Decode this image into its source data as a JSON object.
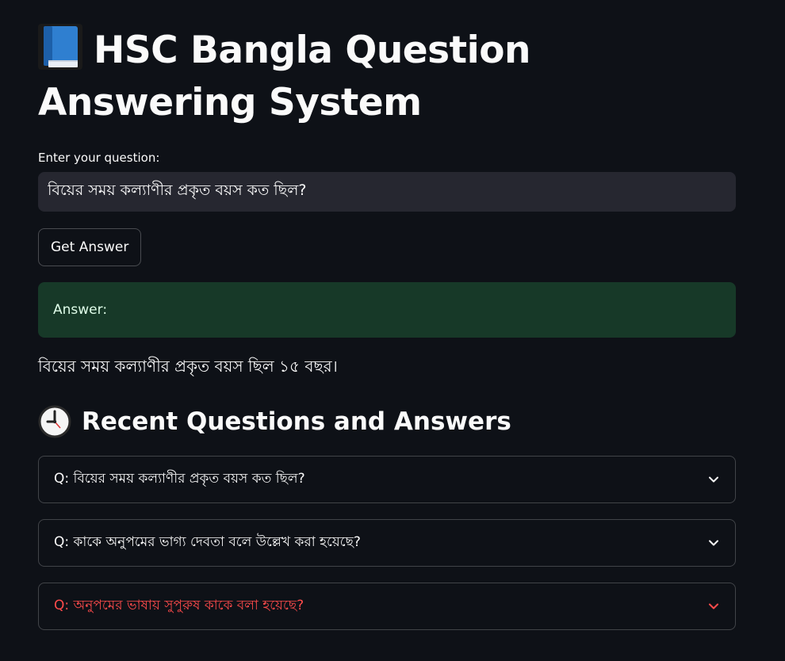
{
  "header": {
    "icon": "blue-book-icon",
    "title": "HSC Bangla Question Answering System"
  },
  "form": {
    "label": "Enter your question:",
    "value": "বিয়ের সময় কল্যাণীর প্রকৃত বয়স কত ছিল?",
    "button_label": "Get Answer"
  },
  "result": {
    "heading": "Answer:",
    "text": "বিয়ের সময় কল্যাণীর প্রকৃত বয়স ছিল ১৫ বছর।"
  },
  "recent": {
    "icon": "clock-icon",
    "title": "Recent Questions and Answers",
    "items": [
      {
        "label": "Q: বিয়ের সময় কল্যাণীর প্রকৃত বয়স কত ছিল?"
      },
      {
        "label": "Q: কাকে অনুপমের ভাগ্য দেবতা বলে উল্লেখ করা হয়েছে?"
      },
      {
        "label": "Q: অনুপমের ভাষায় সুপুরুষ কাকে বলা হয়েছে?"
      }
    ]
  },
  "colors": {
    "background": "#0e1117",
    "input_bg": "#262730",
    "success_bg": "#173928",
    "success_text": "#dffde9",
    "accent": "#ff4b4b"
  }
}
